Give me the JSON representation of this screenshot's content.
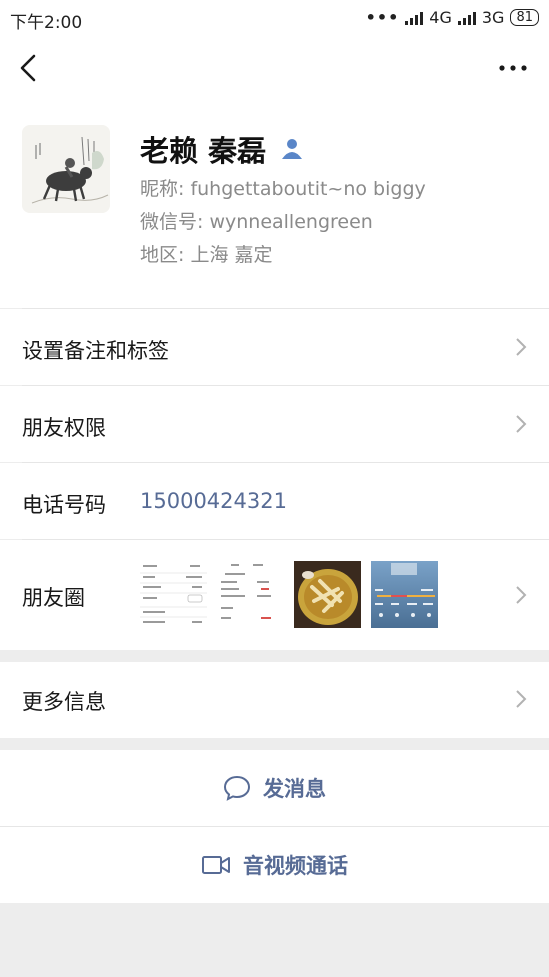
{
  "status_bar": {
    "time": "下午2:00",
    "net1": "4G",
    "net2": "3G",
    "battery": "81"
  },
  "profile": {
    "name": "老赖 秦磊",
    "nickname_label": "昵称: ",
    "nickname": "fuhgettaboutit~no biggy",
    "wechat_label": "微信号: ",
    "wechat_id": "wynneallengreen",
    "region_label": "地区: ",
    "region": "上海  嘉定"
  },
  "rows": {
    "remarks_tags": "设置备注和标签",
    "friend_permissions": "朋友权限",
    "phone_label": "电话号码",
    "phone_number": "15000424321",
    "moments": "朋友圈",
    "more_info": "更多信息"
  },
  "actions": {
    "send_message": "发消息",
    "video_call": "音视频通话"
  },
  "icons": {
    "back": "back-arrow-icon",
    "more": "more-options-icon",
    "contact": "contact-person-icon",
    "chat": "chat-bubble-icon",
    "video": "video-camera-icon"
  },
  "colors": {
    "link_blue": "#576b95",
    "background": "#ededed"
  }
}
